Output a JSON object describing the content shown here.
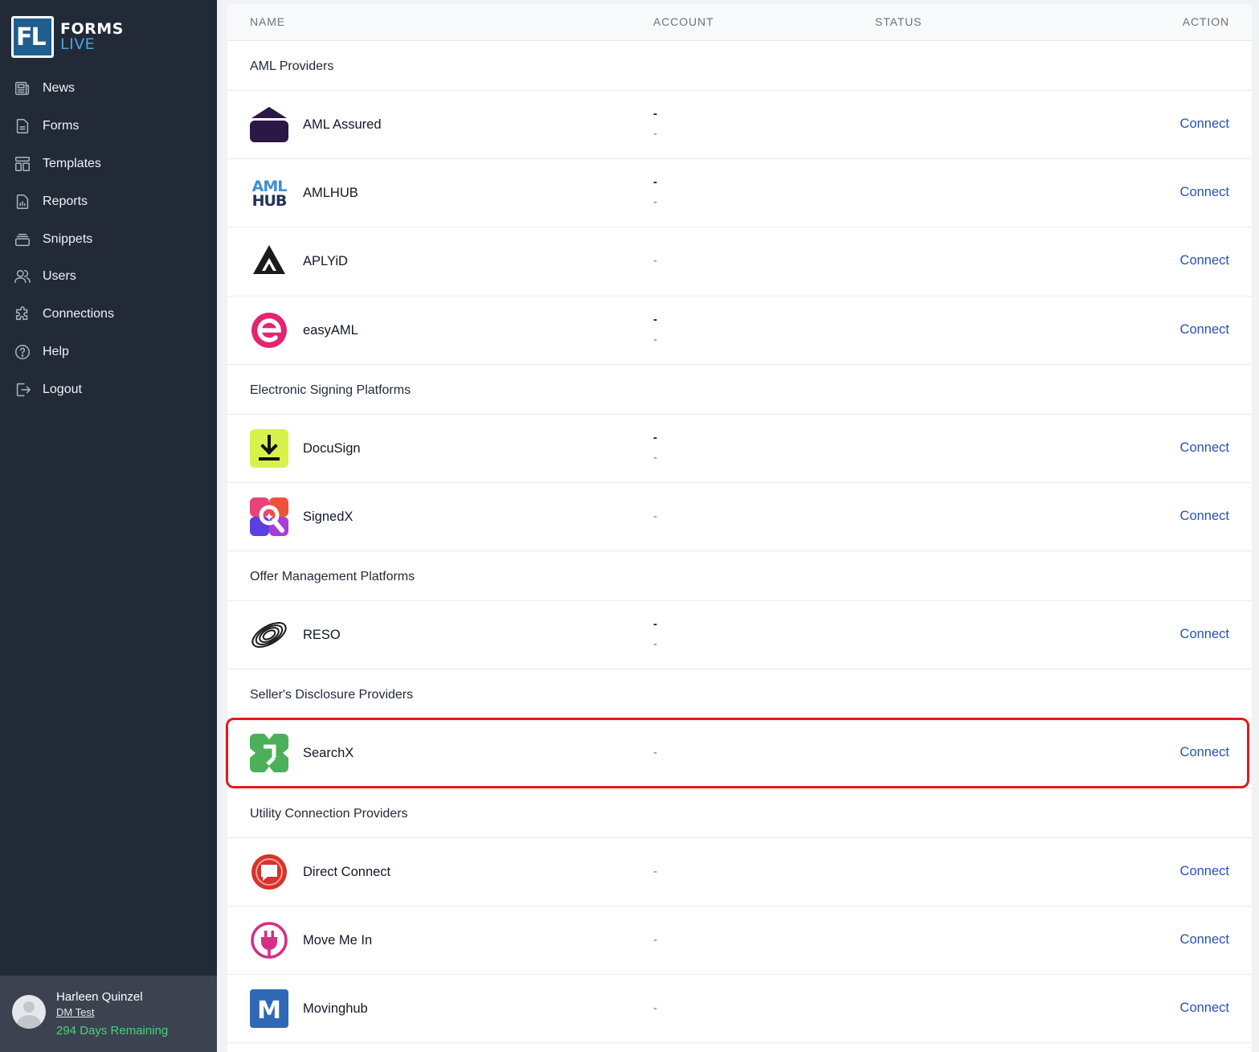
{
  "brand": {
    "logo_mark": "FL",
    "line1": "FORMS",
    "line2": "LIVE"
  },
  "nav": [
    {
      "label": "News",
      "icon": "newspaper-icon"
    },
    {
      "label": "Forms",
      "icon": "document-icon"
    },
    {
      "label": "Templates",
      "icon": "template-icon"
    },
    {
      "label": "Reports",
      "icon": "report-icon"
    },
    {
      "label": "Snippets",
      "icon": "stack-icon"
    },
    {
      "label": "Users",
      "icon": "users-icon"
    },
    {
      "label": "Connections",
      "icon": "puzzle-icon"
    },
    {
      "label": "Help",
      "icon": "help-icon"
    },
    {
      "label": "Logout",
      "icon": "logout-icon"
    }
  ],
  "user": {
    "name": "Harleen Quinzel",
    "org": "DM Test",
    "days_remaining": "294 Days Remaining"
  },
  "table": {
    "headers": {
      "name": "NAME",
      "account": "ACCOUNT",
      "status": "STATUS",
      "action": "ACTION"
    },
    "groups": [
      {
        "title": "AML Providers",
        "rows": [
          {
            "name": "AML Assured",
            "account": [
              "-",
              "-"
            ],
            "action": "Connect",
            "logo": "aml-assured-logo"
          },
          {
            "name": "AMLHUB",
            "account": [
              "-",
              "-"
            ],
            "action": "Connect",
            "logo": "amlhub-logo",
            "logo_text_1": "AML",
            "logo_text_2": "HUB"
          },
          {
            "name": "APLYiD",
            "account": [
              "-"
            ],
            "action": "Connect",
            "logo": "aplyid-logo"
          },
          {
            "name": "easyAML",
            "account": [
              "-",
              "-"
            ],
            "action": "Connect",
            "logo": "easyaml-logo"
          }
        ]
      },
      {
        "title": "Electronic Signing Platforms",
        "rows": [
          {
            "name": "DocuSign",
            "account": [
              "-",
              "-"
            ],
            "action": "Connect",
            "logo": "docusign-logo"
          },
          {
            "name": "SignedX",
            "account": [
              "-"
            ],
            "action": "Connect",
            "logo": "signedx-logo"
          }
        ]
      },
      {
        "title": "Offer Management Platforms",
        "rows": [
          {
            "name": "RESO",
            "account": [
              "-",
              "-"
            ],
            "action": "Connect",
            "logo": "reso-logo"
          }
        ]
      },
      {
        "title": "Seller's Disclosure Providers",
        "rows": [
          {
            "name": "SearchX",
            "account": [
              "-"
            ],
            "action": "Connect",
            "logo": "searchx-logo",
            "highlighted": true
          }
        ]
      },
      {
        "title": "Utility Connection Providers",
        "rows": [
          {
            "name": "Direct Connect",
            "account": [
              "-"
            ],
            "action": "Connect",
            "logo": "direct-connect-logo"
          },
          {
            "name": "Move Me In",
            "account": [
              "-"
            ],
            "action": "Connect",
            "logo": "move-me-in-logo"
          },
          {
            "name": "Movinghub",
            "account": [
              "-"
            ],
            "action": "Connect",
            "logo": "movinghub-logo",
            "logo_text": "M"
          }
        ]
      }
    ]
  },
  "colors": {
    "sidebar": "#222a38",
    "link": "#2553b7",
    "highlight": "#e31b1b",
    "days": "#4cd27a"
  }
}
